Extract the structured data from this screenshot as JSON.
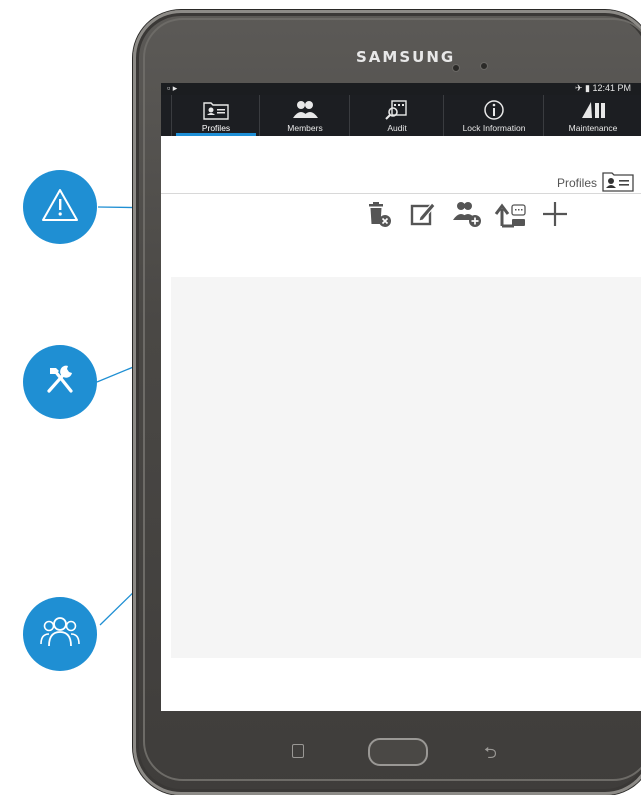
{
  "device": {
    "brand": "SAMSUNG"
  },
  "statusbar": {
    "time": "12:41 PM"
  },
  "nav": {
    "tabs": [
      {
        "label": "Profiles",
        "icon": "profile-card-icon",
        "active": true
      },
      {
        "label": "Members",
        "icon": "members-icon",
        "active": false
      },
      {
        "label": "Audit",
        "icon": "audit-icon",
        "active": false
      },
      {
        "label": "Lock Information",
        "icon": "lock-info-icon",
        "active": false
      },
      {
        "label": "Maintenance",
        "icon": "maintenance-icon",
        "active": false
      }
    ]
  },
  "section": {
    "title": "Profiles"
  },
  "toolbar": {
    "items": [
      {
        "name": "delete-profile",
        "icon": "trash-x-icon"
      },
      {
        "name": "edit-profile",
        "icon": "edit-icon"
      },
      {
        "name": "add-member",
        "icon": "add-member-icon"
      },
      {
        "name": "upload-to-lock",
        "icon": "upload-icon"
      },
      {
        "name": "add-profile",
        "icon": "plus-icon"
      }
    ]
  },
  "callouts": [
    {
      "icon": "warning-icon"
    },
    {
      "icon": "tools-icon"
    },
    {
      "icon": "group-icon"
    }
  ],
  "colors": {
    "accent": "#1f8fd3",
    "navbar": "#1c1e22",
    "content_bg": "#f5f5f5"
  }
}
